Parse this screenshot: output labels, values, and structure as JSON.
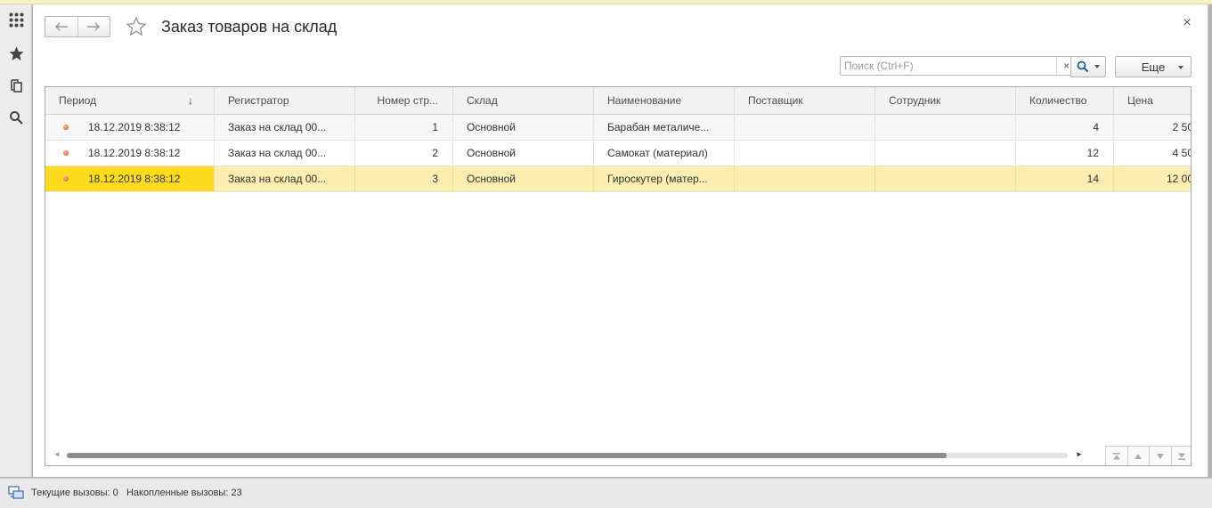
{
  "window": {
    "title": "Заказ товаров на склад",
    "close_label": "×"
  },
  "leftbar": {
    "icons": [
      "apps-grid-icon",
      "favorites-star-icon",
      "history-icon",
      "search-icon"
    ]
  },
  "toolbar": {
    "search_placeholder": "Поиск (Ctrl+F)",
    "search_value": "",
    "clear_label": "×",
    "more_label": "Еще"
  },
  "table": {
    "columns": [
      {
        "label": "Период",
        "sorted": "desc"
      },
      {
        "label": "Регистратор"
      },
      {
        "label": "Номер стр..."
      },
      {
        "label": "Склад"
      },
      {
        "label": "Наименование"
      },
      {
        "label": "Поставщик"
      },
      {
        "label": "Сотрудник"
      },
      {
        "label": "Количество"
      },
      {
        "label": "Цена"
      }
    ],
    "sort_indicator": "↓",
    "rows": [
      {
        "period": "18.12.2019 8:38:12",
        "registrar": "Заказ на склад 00...",
        "line_no": "1",
        "warehouse": "Основной",
        "name": "Барабан металиче...",
        "supplier": "",
        "employee": "",
        "quantity": "4",
        "price": "2 50"
      },
      {
        "period": "18.12.2019 8:38:12",
        "registrar": "Заказ на склад 00...",
        "line_no": "2",
        "warehouse": "Основной",
        "name": "Самокат (материал)",
        "supplier": "",
        "employee": "",
        "quantity": "12",
        "price": "4 50"
      },
      {
        "period": "18.12.2019 8:38:12",
        "registrar": "Заказ на склад 00...",
        "line_no": "3",
        "warehouse": "Основной",
        "name": "Гироскутер (матер...",
        "supplier": "",
        "employee": "",
        "quantity": "14",
        "price": "12 00"
      }
    ],
    "selected_row": 3,
    "hscroll_position": 0.88
  },
  "statusbar": {
    "text": "Текущие вызовы: 0   Накопленные вызовы: 23"
  },
  "colors": {
    "selected_row": "#fbeeb0",
    "selected_cell": "#fcdb1f",
    "top_accent": "#f6f2c6"
  }
}
